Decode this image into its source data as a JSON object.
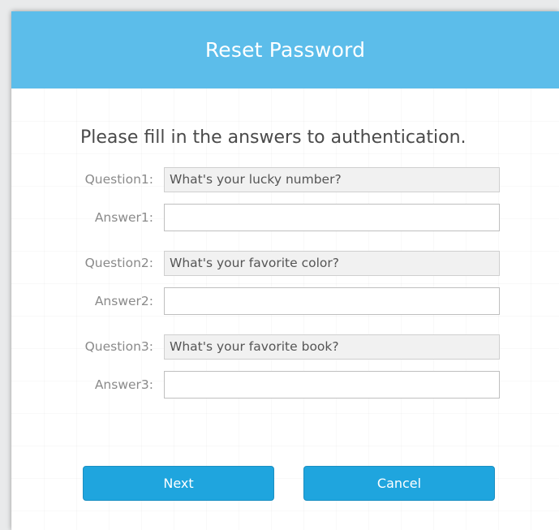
{
  "dialog": {
    "title": "Reset Password",
    "instruction": "Please fill in the answers to authentication."
  },
  "questions": [
    {
      "label": "Question1:",
      "question": "What's your lucky number?",
      "answer_label": "Answer1:",
      "answer_value": ""
    },
    {
      "label": "Question2:",
      "question": "What's your favorite color?",
      "answer_label": "Answer2:",
      "answer_value": ""
    },
    {
      "label": "Question3:",
      "question": "What's your favorite book?",
      "answer_label": "Answer3:",
      "answer_value": ""
    }
  ],
  "buttons": {
    "next_label": "Next",
    "cancel_label": "Cancel"
  },
  "colors": {
    "titlebar": "#5cbdea",
    "button": "#1fa5de"
  }
}
